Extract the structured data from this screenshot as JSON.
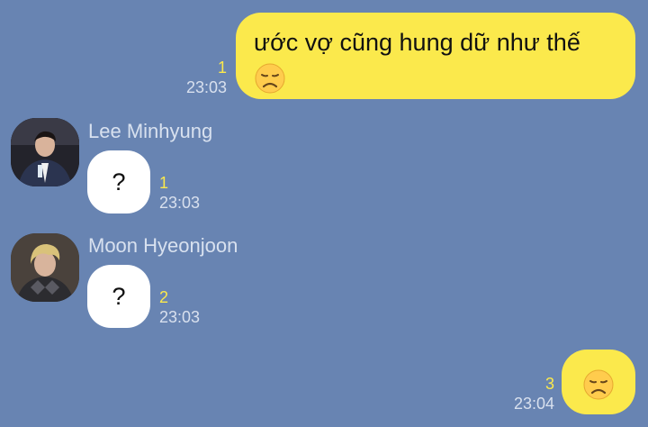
{
  "messages": [
    {
      "sender": "me",
      "text": "ước vợ cũng hung dữ như thế",
      "emoji": "disappointed-face",
      "unread": "1",
      "time": "23:03"
    },
    {
      "sender": "Lee Minhyung",
      "text": "?",
      "unread": "1",
      "time": "23:03"
    },
    {
      "sender": "Moon Hyeonjoon",
      "text": "?",
      "unread": "2",
      "time": "23:03"
    },
    {
      "sender": "me",
      "text": "",
      "emoji": "disappointed-face",
      "unread": "3",
      "time": "23:04"
    }
  ],
  "colors": {
    "background": "#6884b2",
    "outgoing_bubble": "#fbe94c",
    "incoming_bubble": "#ffffff",
    "unread_count": "#fbe94c"
  }
}
